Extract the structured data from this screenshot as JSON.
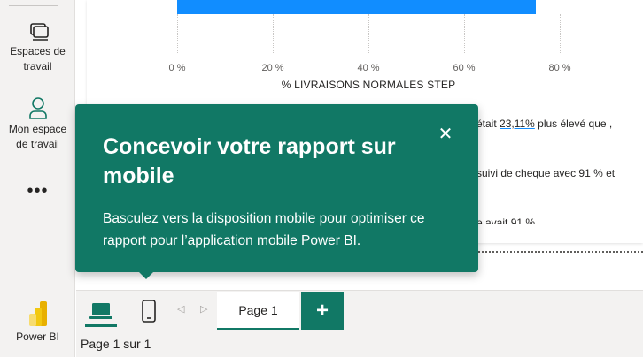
{
  "nav": {
    "workspaces_line1": "Espaces de",
    "workspaces_line2": "travail",
    "my_workspace_line1": "Mon espace",
    "my_workspace_line2": "de travail",
    "more": "•••",
    "powerbi": "Power BI"
  },
  "chart": {
    "ticks": [
      "0 %",
      "20 %",
      "40 %",
      "60 %",
      "80 %"
    ],
    "axis_title": "% LIVRAISONS NORMALES STEP"
  },
  "chart_data": {
    "type": "bar",
    "orientation": "horizontal",
    "xlabel": "% LIVRAISONS NORMALES STEP",
    "xlim": [
      0,
      82
    ],
    "values": [
      75
    ],
    "bar_color": "#118dff"
  },
  "narrative": {
    "line1_pre": "était ",
    "line1_hl": "23,11%",
    "line1_post": " plus élevé que ,",
    "line2_pre": "suivi de ",
    "line2_hl1": "cheque",
    "line2_mid": " avec ",
    "line2_hl2": "91 %",
    "line2_post": " et",
    "line3": "e avait 91 %"
  },
  "bubble": {
    "title": "Concevoir votre rapport sur mobile",
    "body": "Basculez vers la disposition mobile pour optimiser ce rapport pour l’application mobile Power BI.",
    "close": "✕",
    "color": "#117865"
  },
  "pagebar": {
    "prev": "◁",
    "next": "▷",
    "page_tab": "Page 1",
    "add": "+"
  },
  "status": {
    "text": "Page 1 sur 1"
  }
}
